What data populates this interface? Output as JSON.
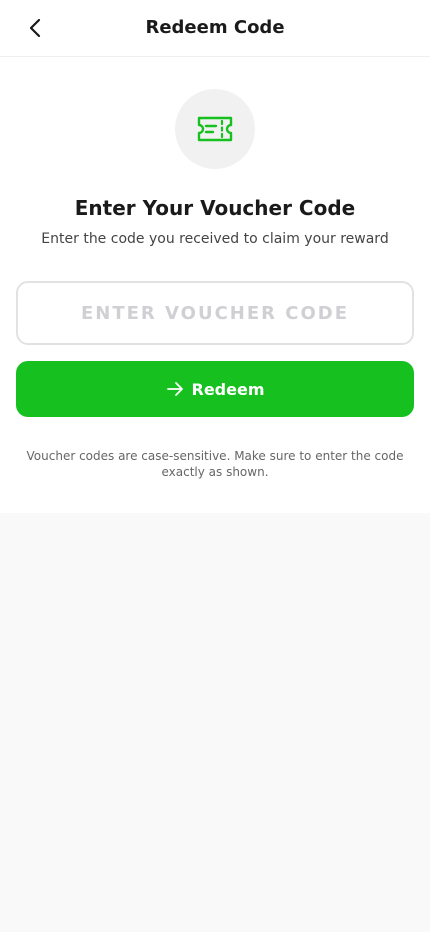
{
  "header": {
    "back_icon": "chevron-left-icon",
    "title": "Redeem Code"
  },
  "hero": {
    "icon": "ticket-icon",
    "icon_color": "#16c11f",
    "title": "Enter Your Voucher Code",
    "subtitle": "Enter the code you received to claim your reward"
  },
  "form": {
    "input_value": "",
    "input_placeholder": "ENTER VOUCHER CODE",
    "submit_icon": "arrow-right-icon",
    "submit_label": "Redeem",
    "submit_color": "#16c11f"
  },
  "note": "Voucher codes are case-sensitive. Make sure to enter the code exactly as shown."
}
